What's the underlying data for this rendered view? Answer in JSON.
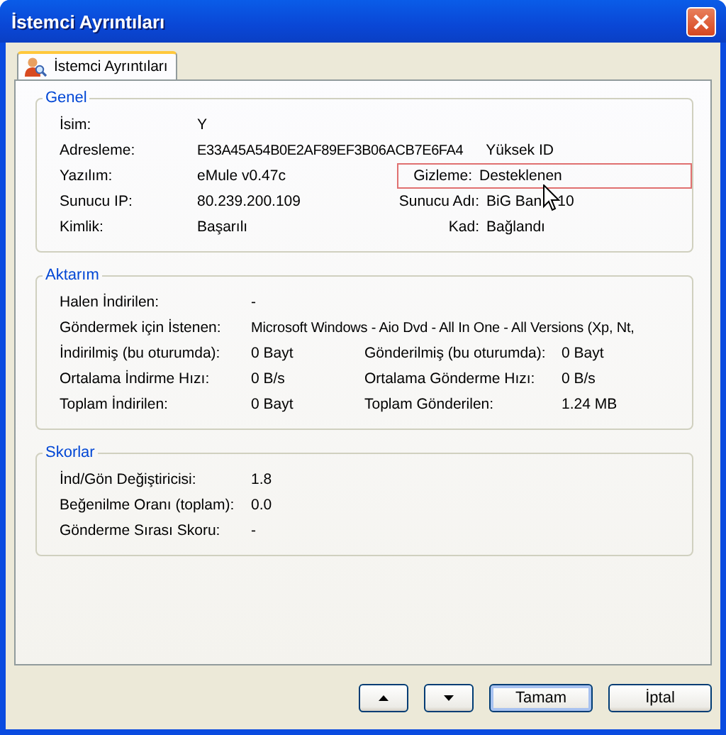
{
  "window": {
    "title": "İstemci Ayrıntıları"
  },
  "tabs": [
    {
      "label": "İstemci Ayrıntıları",
      "selected": true
    }
  ],
  "groups": [
    {
      "title": "Genel",
      "kind": "general",
      "rows": [
        {
          "label": "İsim:",
          "value": "Y"
        },
        {
          "label": "Adresleme:",
          "value": "E33A45A54B0E2AF89EF3B06ACB7E6FA4",
          "note": "Yüksek ID"
        },
        {
          "label": "Yazılım:",
          "value": "eMule v0.47c",
          "label2": "Gizleme:",
          "value2": "Desteklenen",
          "highlighted": true
        },
        {
          "label": "Sunucu IP:",
          "value": "80.239.200.109",
          "label2": "Sunucu Adı:",
          "value2": "BiG Ban",
          "value2_tail": "10",
          "cursor": true
        },
        {
          "label": "Kimlik:",
          "value": "Başarılı",
          "label2": "Kad:",
          "value2": "Bağlandı"
        }
      ]
    },
    {
      "title": "Aktarım",
      "kind": "transfer",
      "rows": [
        {
          "label": "Halen İndirilen:",
          "value": "-"
        },
        {
          "label": "Göndermek için İstenen:",
          "value": "Microsoft Windows - Aio Dvd - All In One - All Versions (Xp, Nt,",
          "kind": "wide"
        },
        {
          "label": "İndirilmiş (bu oturumda):",
          "value": "0 Bayt",
          "label2": "Gönderilmiş (bu oturumda):",
          "value2": "0 Bayt"
        },
        {
          "label": "Ortalama İndirme Hızı:",
          "value": "0 B/s",
          "label2": "Ortalama Gönderme Hızı:",
          "value2": "0 B/s"
        },
        {
          "label": "Toplam İndirilen:",
          "value": "0 Bayt",
          "label2": "Toplam Gönderilen:",
          "value2": "1.24 MB"
        }
      ]
    },
    {
      "title": "Skorlar",
      "kind": "scores",
      "rows": [
        {
          "label": "İnd/Gön Değiştiricisi:",
          "value": "1.8"
        },
        {
          "label": "Beğenilme Oranı (toplam):",
          "value": "0.0"
        },
        {
          "label": "Gönderme Sırası Skoru:",
          "value": "-"
        }
      ]
    }
  ],
  "buttons": [
    {
      "kind": "up"
    },
    {
      "kind": "down"
    },
    {
      "kind": "text",
      "label": "Tamam",
      "default": true
    },
    {
      "kind": "text",
      "label": "İptal",
      "default": false
    }
  ]
}
